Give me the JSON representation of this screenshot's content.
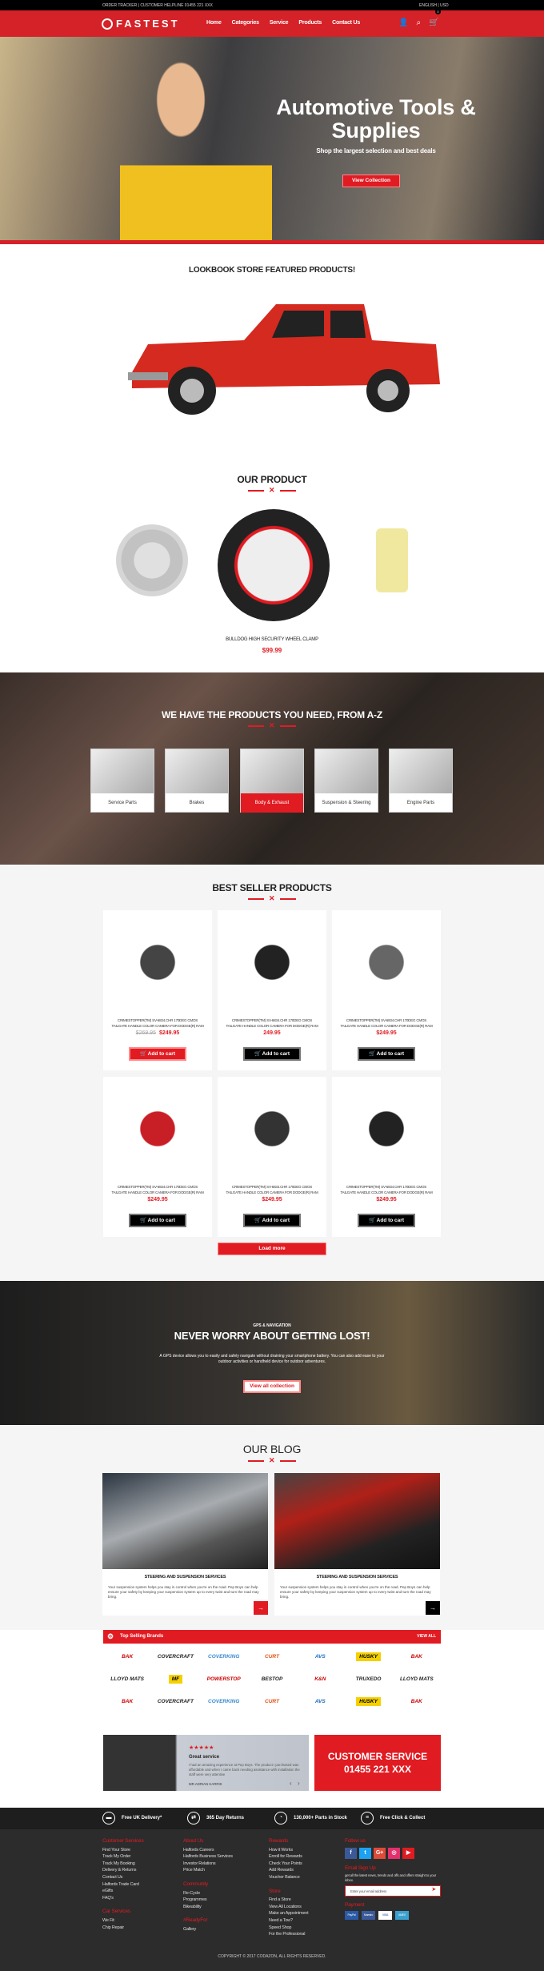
{
  "topbar": {
    "left": "ORDER TRACKER  |  CUSTOMER HELPLINE  01455 221 XXX",
    "right": "ENGLISH  |  USD"
  },
  "nav": {
    "logo": "FASTEST",
    "menu": [
      "Home",
      "Categories",
      "Service",
      "Products",
      "Contact Us"
    ],
    "cart_count": "0"
  },
  "hero": {
    "title": "Automotive Tools & Supplies",
    "subtitle": "Shop the largest selection and best deals",
    "button": "View Collection"
  },
  "lookbook": {
    "title": "LOOKBOOK STORE FEATURED PRODUCTS!"
  },
  "our_product": {
    "title": "OUR PRODUCT",
    "product_name": "BULLDOG HIGH SECURITY WHEEL CLAMP",
    "price": "$99.99"
  },
  "az": {
    "title": "WE HAVE THE PRODUCTS YOU NEED, FROM A-Z",
    "categories": [
      "Service Parts",
      "Brakes",
      "Body & Exhaust",
      "Suspension & Steering",
      "Engine Parts"
    ]
  },
  "best": {
    "title": "BEST SELLER PRODUCTS",
    "product_name": "CRIMESTOPPER(TM) SV-6834.CHR 170DEG CMOS TAILGATE HANDLE COLOR CAMERA FOR DODGE(R) RAM",
    "items": [
      {
        "old": "$269.95",
        "price": "$249.95"
      },
      {
        "price": "249.95"
      },
      {
        "price": "$249.95"
      },
      {
        "price": "$249.95"
      },
      {
        "price": "$249.95"
      },
      {
        "price": "$249.95"
      }
    ],
    "add_to_cart": "Add to cart",
    "load_more": "Load more"
  },
  "gps": {
    "kicker": "GPS & NAVIGATION",
    "title": "NEVER WORRY ABOUT GETTING LOST!",
    "text": "A GPS device allows you to easily and safely navigate without draining your smartphone battery. You can also add ease to your outdoor activities or handheld device for outdoor adventures.",
    "button": "View all collection"
  },
  "blog": {
    "title": "OUR BLOG",
    "posts": [
      {
        "title": "STEERING AND SUSPENSION SERVICES",
        "text": "Your suspension system helps you stay in control when you're on the road. Pep Boys can help ensure your safety by keeping your suspension system up to every twist and turn the road may bring."
      },
      {
        "title": "STEERING AND SUSPENSION SERVICES",
        "text": "Your suspension system helps you stay in control when you're on the road. Pep Boys can help ensure your safety by keeping your suspension system up to every twist and turn the road may bring."
      }
    ]
  },
  "brands": {
    "title": "Top Selling Brands",
    "view_all": "VIEW ALL",
    "logos": [
      "BAK",
      "COVERCRAFT",
      "COVERKING",
      "CURT",
      "AVS",
      "HUSKY",
      "BAK",
      "LLOYD MATS",
      "MF",
      "POWERSTOP",
      "BESTOP",
      "K&N",
      "TRUXEDO",
      "LLOYD MATS",
      "BAK",
      "COVERCRAFT",
      "COVERKING",
      "CURT",
      "AVS",
      "HUSKY",
      "BAK"
    ]
  },
  "review": {
    "stars": "★★★★★",
    "title": "Great service",
    "text": "I had an amazing experience at Pep Boys. The product I purchased was affordable and when I came back needing assistance with installation the staff were very attentive",
    "author": "MR.ADRIAN HARRIS"
  },
  "customer_service": {
    "title": "CUSTOMER SERVICE",
    "phone": "01455 221 XXX"
  },
  "features": [
    "Free UK Delivery*",
    "365 Day Returns",
    "130,000+ Parts in Stock",
    "Free Click & Collect"
  ],
  "footer": {
    "customer_services": {
      "title": "Customer Services",
      "links": [
        "Find Your Store",
        "Track My Order",
        "Track My Booking",
        "Delivery & Returns",
        "Contact Us",
        "Halfords Trade Card",
        "eGifts",
        "FAQ's"
      ]
    },
    "car_services": {
      "title": "Car Services",
      "links": [
        "We Fit",
        "Chip Repair"
      ]
    },
    "about": {
      "title": "About Us",
      "links": [
        "Halfords Careers",
        "Halfords Business Services",
        "Investor Relations",
        "Price Match"
      ]
    },
    "community": {
      "title": "Community",
      "links": [
        "Re-Cycle",
        "Programmes",
        "Bikeability"
      ]
    },
    "ready": {
      "title": "#ReadyFor",
      "links": [
        "Gallery"
      ]
    },
    "rewards": {
      "title": "Rewards",
      "links": [
        "How it Works",
        "Enroll for Rewards",
        "Check Your Points",
        "Add Rewards",
        "Voucher Balance"
      ]
    },
    "store": {
      "title": "Store",
      "links": [
        "Find a Store",
        "View All Locations",
        "Make an Appointment",
        "Need a Tow?",
        "Speed Shop",
        "For the Professional"
      ]
    },
    "follow": "Follow us",
    "email_title": "Email Sign Up",
    "email_text": "get all the latest news, trends and offs and offers straight to your inbox.",
    "email_placeholder": "Enter your email address",
    "payment": "Payment",
    "payments": [
      "PayPal",
      "Maestro",
      "VISA",
      "AMEX"
    ],
    "copyright": "COPYRIGHT © 2017 CODAZON, ALL RIGHTS RESERVED."
  },
  "colors": {
    "red": "#e11b22",
    "dark": "#2c2c2c"
  }
}
